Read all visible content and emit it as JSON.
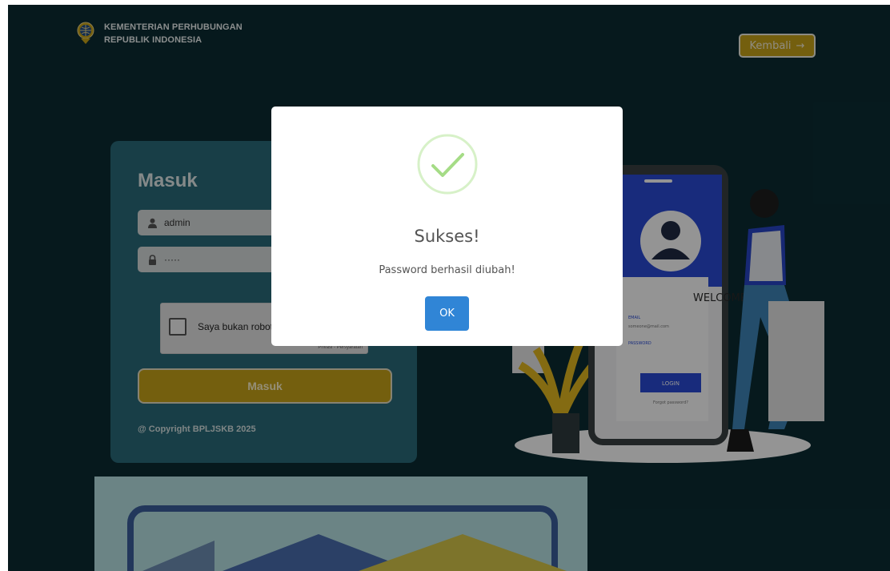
{
  "header": {
    "org_line1": "KEMENTERIAN PERHUBUNGAN",
    "org_line2": "REPUBLIK INDONESIA",
    "back_label": "Kembali",
    "back_arrow": "→"
  },
  "login": {
    "title": "Masuk",
    "username_value": "admin",
    "password_value": "·····",
    "captcha_label": "Saya bukan robot",
    "captcha_terms": "Privasi - Persyaratan",
    "submit_label": "Masuk",
    "copyright": "@ Copyright BPLJSKB 2025"
  },
  "illustration": {
    "welcome": "WELCOME",
    "email_label": "EMAIL",
    "email_value": "someone@mail.com",
    "password_label": "PASSWORD",
    "login_label": "LOGIN",
    "forgot_label": "Forgot password?"
  },
  "modal": {
    "title": "Sukses!",
    "message": "Password berhasil diubah!",
    "ok_label": "OK"
  },
  "colors": {
    "page_bg": "#0b2c33",
    "card_bg": "#2a6c7a",
    "gold": "#c9a419",
    "success_green": "#a5dc86",
    "ok_blue": "#3085d6"
  }
}
